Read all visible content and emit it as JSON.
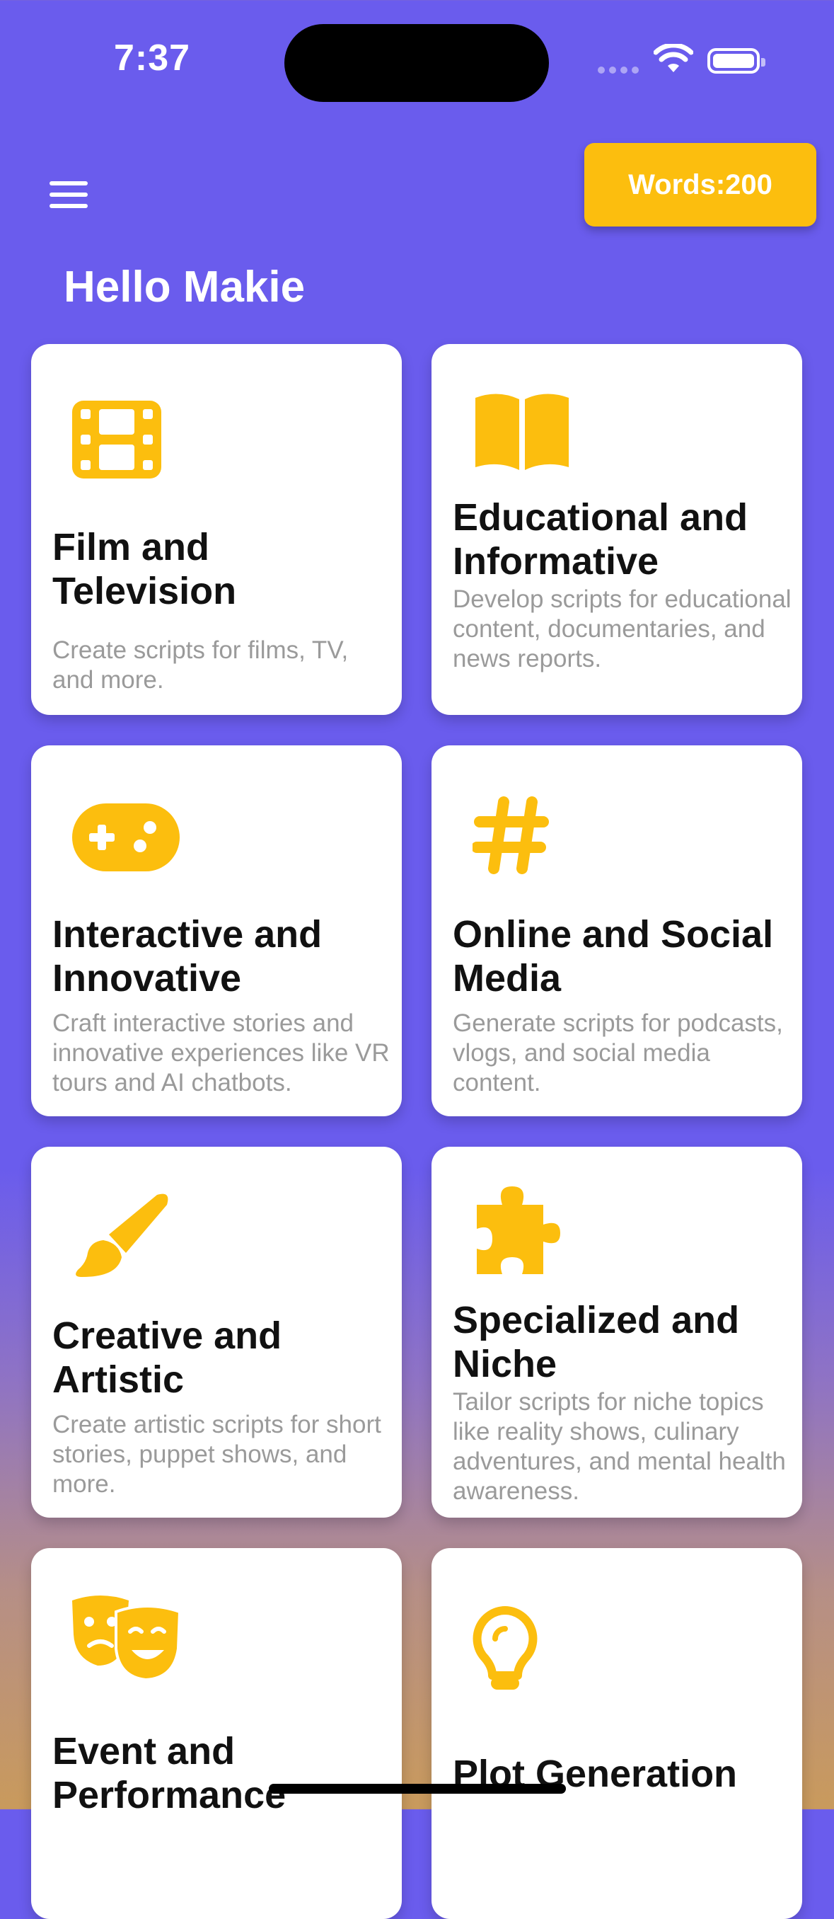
{
  "status": {
    "time": "7:37"
  },
  "header": {
    "words_label": "Words:200",
    "greeting": "Hello Makie"
  },
  "icon_color": "#fcbe0e",
  "cards": [
    {
      "icon": "film-icon",
      "title": "Film and Television",
      "description": "Create scripts for films, TV, and more."
    },
    {
      "icon": "book-icon",
      "title": "Educational and Informative",
      "description": "Develop scripts for educational content, documentaries, and news reports."
    },
    {
      "icon": "gamepad-icon",
      "title": "Interactive and Innovative",
      "description": "Craft interactive stories and innovative experiences like VR tours and AI chatbots."
    },
    {
      "icon": "hashtag-icon",
      "title": "Online and Social Media",
      "description": "Generate scripts for podcasts, vlogs, and social media content."
    },
    {
      "icon": "paintbrush-icon",
      "title": "Creative and Artistic",
      "description": "Create artistic scripts for short stories, puppet shows, and more."
    },
    {
      "icon": "puzzle-icon",
      "title": "Specialized and Niche",
      "description": "Tailor scripts for niche topics like reality shows, culinary adventures, and mental health awareness."
    },
    {
      "icon": "theater-masks-icon",
      "title": "Event and Performance",
      "description": ""
    },
    {
      "icon": "lightbulb-icon",
      "title": "Plot Generation",
      "description": ""
    }
  ]
}
